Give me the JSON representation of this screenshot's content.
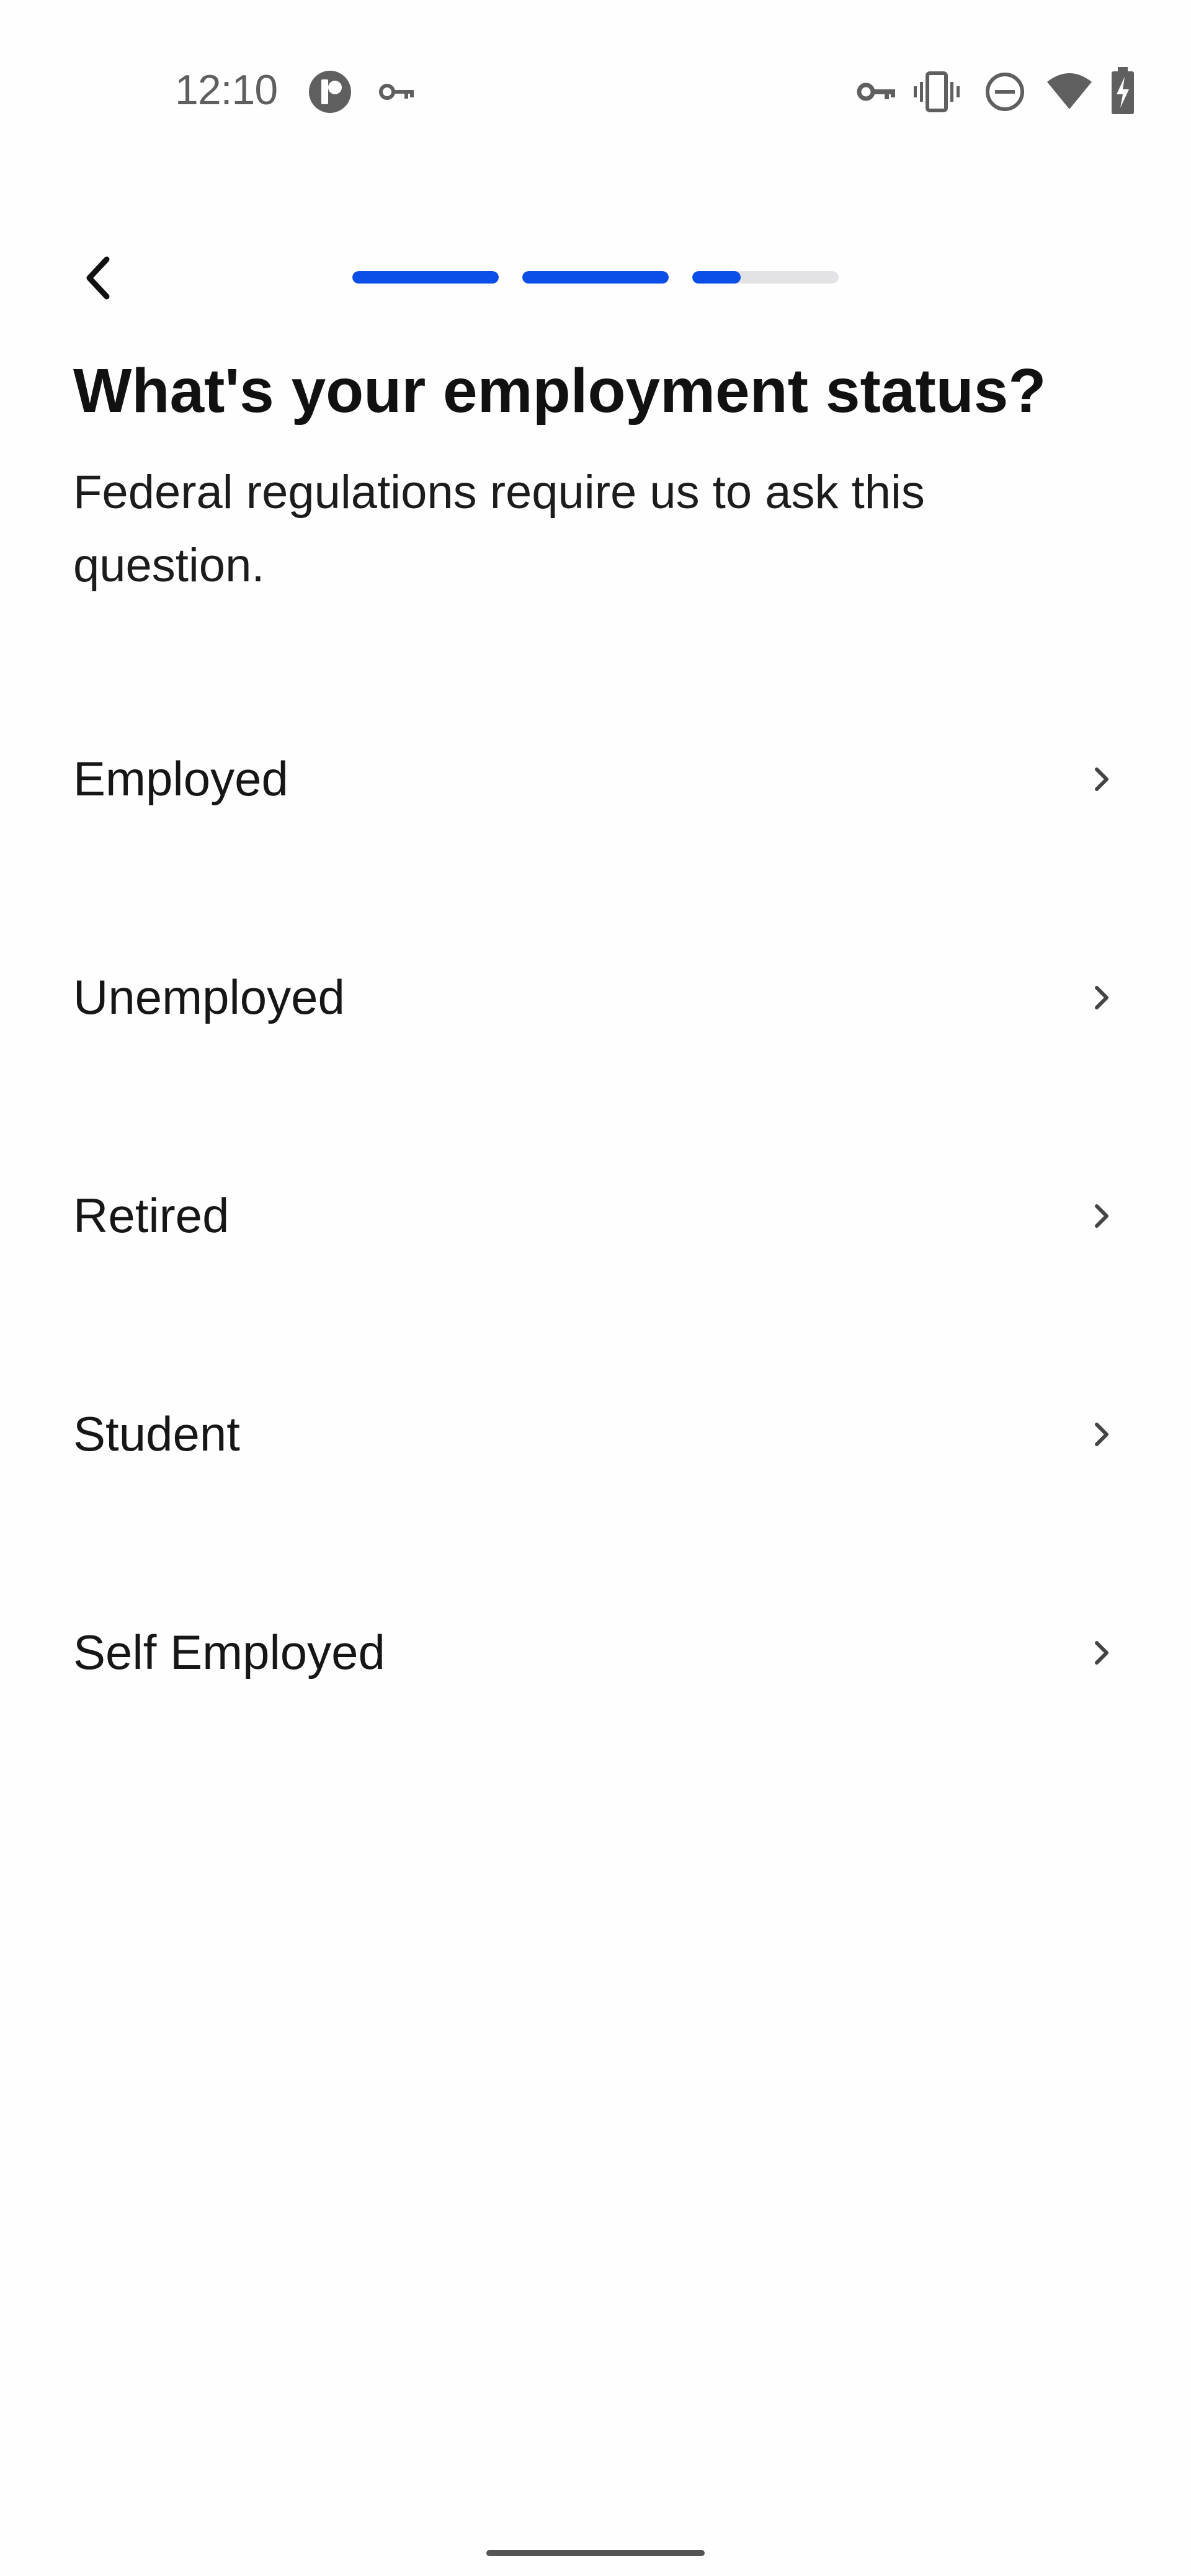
{
  "status_bar": {
    "time": "12:10",
    "left_icons": [
      "app-notification-icon",
      "vpn-key-icon"
    ],
    "right_icons": [
      "vpn-key-icon",
      "vibrate-icon",
      "do-not-disturb-icon",
      "wifi-icon",
      "battery-charging-icon"
    ]
  },
  "nav": {
    "back_icon": "chevron-left-icon",
    "progress_steps": [
      {
        "fraction": 1.0
      },
      {
        "fraction": 1.0
      },
      {
        "fraction": 0.33
      }
    ]
  },
  "header": {
    "title": "What's your employment status?",
    "subtitle": "Federal regulations require us to ask this question."
  },
  "options": [
    {
      "label": "Employed"
    },
    {
      "label": "Unemployed"
    },
    {
      "label": "Retired"
    },
    {
      "label": "Student"
    },
    {
      "label": "Self Employed"
    }
  ],
  "colors": {
    "accent": "#0B4EE8",
    "track": "#E3E3E6",
    "background": "#FEFEFE",
    "text": "#111111",
    "icon": "#5F5F5F"
  }
}
